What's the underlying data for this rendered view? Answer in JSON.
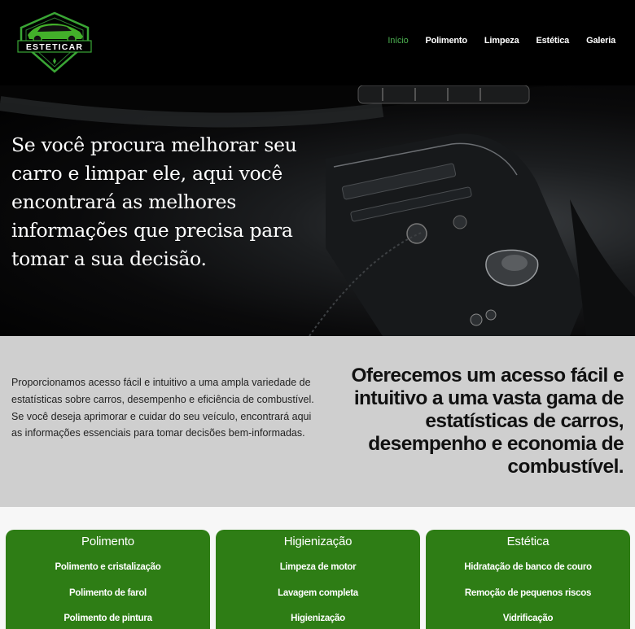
{
  "header": {
    "logo_text": "ESTETICAR",
    "nav": [
      {
        "label": "Início",
        "active": true
      },
      {
        "label": "Polimento",
        "active": false
      },
      {
        "label": "Limpeza",
        "active": false
      },
      {
        "label": "Estética",
        "active": false
      },
      {
        "label": "Galeria",
        "active": false
      }
    ]
  },
  "hero": {
    "text": " Se você procura melhorar seu carro e limpar ele, aqui você encontrará as melhores informações que precisa para tomar a sua decisão."
  },
  "intro": {
    "paragraph": "Proporcionamos acesso fácil e intuitivo a uma ampla variedade de estatísticas sobre carros, desempenho e eficiência de combustível. Se você deseja aprimorar e cuidar do seu veículo, encontrará aqui as informações essenciais para tomar decisões bem-informadas.",
    "heading": "Oferecemos um acesso fácil e intuitivo a uma vasta gama de estatísticas de carros, desempenho e economia de combustível."
  },
  "cards": [
    {
      "title": "Polimento",
      "items": [
        "Polimento e cristalização",
        "Polimento de farol",
        "Polimento de pintura"
      ]
    },
    {
      "title": "Higienização",
      "items": [
        "Limpeza de motor",
        "Lavagem completa",
        "Higienização"
      ]
    },
    {
      "title": "Estética",
      "items": [
        "Hidratação de banco de couro",
        "Remoção de pequenos riscos",
        "Vidrificação"
      ]
    }
  ],
  "colors": {
    "accent": "#4caf50",
    "card_bg": "#2e7d15",
    "header_bg": "#000000",
    "intro_bg": "#cfcfcf"
  }
}
